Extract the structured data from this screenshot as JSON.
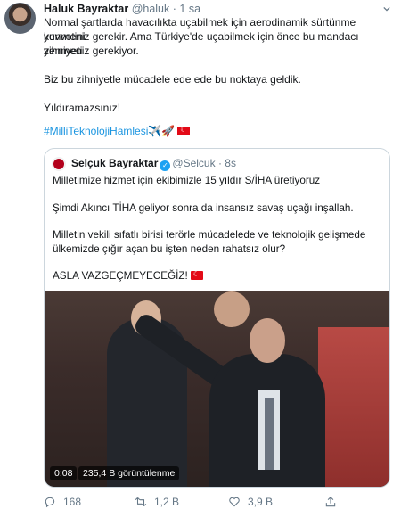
{
  "author": {
    "name": "Haluk Bayraktar",
    "handle": "@haluk",
    "separator": "·",
    "time": "1 sa"
  },
  "tweet": {
    "line1": "Normal şartlarda havacılıkta uçabilmek için aerodinamik sürtünme kuvvetini",
    "line2": "yenmeniz gerekir. Ama Türkiye'de uçabilmek için önce bu mandacı zihniyeti",
    "line3": "yenmeniz gerekiyor.",
    "line4": "Biz bu zihniyetle mücadele ede ede bu noktaya geldik.",
    "line5": "Yıldıramazsınız!",
    "hashtag": "#MilliTeknolojiHamlesi",
    "emoji": "✈️🚀"
  },
  "quoted": {
    "name": "Selçuk Bayraktar",
    "handle": "@Selcuk",
    "separator": "·",
    "time": "8s",
    "p1": "Milletimize hizmet için ekibimizle 15 yıldır S/İHA üretiyoruz",
    "p2": "Şimdi Akıncı TİHA geliyor sonra da insansız savaş uçağı inşallah.",
    "p3a": "Milletin vekili sıfatlı birisi terörle mücadelede ve teknolojik gelişmede",
    "p3b": "ülkemizde çığır açan bu işten neden rahatsız olur?",
    "p4": "ASLA VAZGEÇMEYECEĞİZ!",
    "video": {
      "duration": "0:08",
      "views": "235,4 B görüntülenme"
    }
  },
  "actions": {
    "replies": "168",
    "retweets": "1,2 B",
    "likes": "3,9 B"
  },
  "colors": {
    "accent": "#1b95e0",
    "muted": "#657786",
    "border": "#ccd6dd",
    "flag": "#e30a17"
  }
}
